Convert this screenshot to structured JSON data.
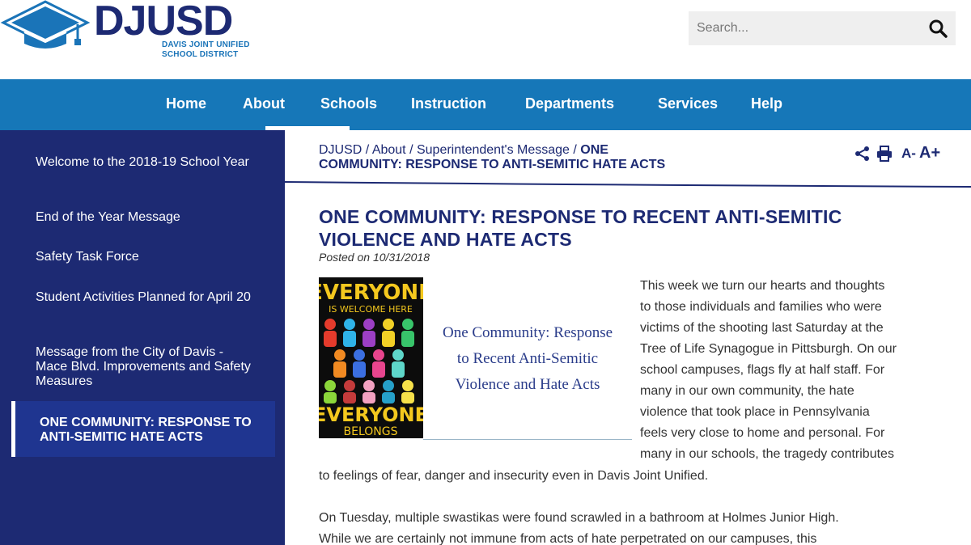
{
  "logo": {
    "brand": "DJUSD",
    "subtitle_line1": "DAVIS JOINT UNIFIED",
    "subtitle_line2": "SCHOOL DISTRICT"
  },
  "search": {
    "placeholder": "Search..."
  },
  "nav": {
    "items": [
      "Home",
      "About",
      "Schools",
      "Instruction",
      "Departments",
      "Services",
      "Help"
    ],
    "active": "About"
  },
  "sidebar": {
    "items": [
      {
        "label": "Welcome to the 2018-19 School Year"
      },
      {
        "label": "End of the Year Message"
      },
      {
        "label": "Safety Task Force"
      },
      {
        "label": "Student Activities Planned for April 20"
      },
      {
        "label": "Message from the City of Davis - Mace Blvd. Improvements and Safety Measures"
      },
      {
        "label": "ONE COMMUNITY: RESPONSE TO ANTI-SEMITIC HATE ACTS",
        "active": true
      }
    ]
  },
  "breadcrumb": {
    "items": [
      "DJUSD",
      "About",
      "Superintendent's Message"
    ],
    "separator": "/",
    "current": "ONE COMMUNITY: RESPONSE TO ANTI-SEMITIC HATE ACTS"
  },
  "tools": {
    "decrease_font": "A-",
    "increase_font": "A+"
  },
  "article": {
    "title": "ONE COMMUNITY: RESPONSE TO RECENT ANTI-SEMITIC VIOLENCE AND HATE ACTS",
    "posted": "Posted on 10/31/2018",
    "poster": {
      "top_line1": "EVERYONE",
      "top_line2": "IS WELCOME HERE",
      "bottom_line1": "EVERYONE",
      "bottom_line2": "BELONGS"
    },
    "image_caption": [
      "One Community: Response",
      "to Recent Anti-Semitic",
      "Violence and Hate Acts"
    ],
    "paragraph1_lines": [
      "This week we turn our hearts and thoughts",
      "to those individuals and families who were",
      "victims of the shooting last Saturday at the",
      "Tree of Life Synagogue in Pittsburgh. On our",
      "school campuses, flags fly at half staff. For",
      "many in our own community, the hate",
      "violence that took place in Pennsylvania",
      "feels very close to home and personal. For",
      "many in our schools, the tragedy contributes"
    ],
    "paragraph1_tail": "to feelings of fear, danger and insecurity even in Davis Joint Unified.",
    "paragraph2_lines": [
      "On Tuesday, multiple swastikas were found scrawled in a bathroom at Holmes Junior High.",
      "While we are certainly not immune from acts of hate perpetrated on our campuses, this"
    ]
  },
  "colors": {
    "navy": "#1d2a73",
    "nav_blue": "#1677b8",
    "sidebar_active": "#1f3590",
    "brand_light_blue": "#1a74b8"
  }
}
